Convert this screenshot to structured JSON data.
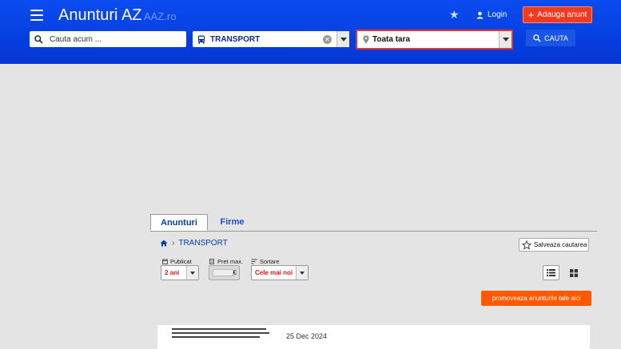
{
  "header": {
    "brand": "Anunturi AZ",
    "brand_sub": "AAZ.ro",
    "login_label": "Login",
    "add_label": "Adauga anunt",
    "search_placeholder": "Cauta acum ...",
    "category_value": "TRANSPORT",
    "location_value": "Toata tara",
    "search_button_label": "CAUTA"
  },
  "tabs": [
    {
      "label": "Anunturi",
      "active": true
    },
    {
      "label": "Firme",
      "active": false
    }
  ],
  "breadcrumb": {
    "separator": "›",
    "current": "TRANSPORT"
  },
  "save_search_label": "Salveaza cautarea",
  "filters": {
    "publicat": {
      "label": "Publicat",
      "value": "2 ani"
    },
    "pret": {
      "label": "Pret max.",
      "currency": "€"
    },
    "sortare": {
      "label": "Sortare",
      "value": "Cele mai noi"
    }
  },
  "promo_label": "promoveaza anunturile tale aici",
  "listings": [
    {
      "date": "25 Dec 2024"
    }
  ],
  "colors": {
    "header_blue": "#0a4cf0",
    "accent_red": "#f23a1e",
    "promo_orange": "#ff5a00",
    "link_blue": "#0b3ea8"
  },
  "icons": [
    "menu-icon",
    "star-icon",
    "user-icon",
    "plus-icon",
    "search-icon",
    "bus-icon",
    "location-icon",
    "home-icon",
    "calendar-icon",
    "price-tag-icon",
    "sort-icon",
    "list-view-icon",
    "grid-view-icon"
  ]
}
